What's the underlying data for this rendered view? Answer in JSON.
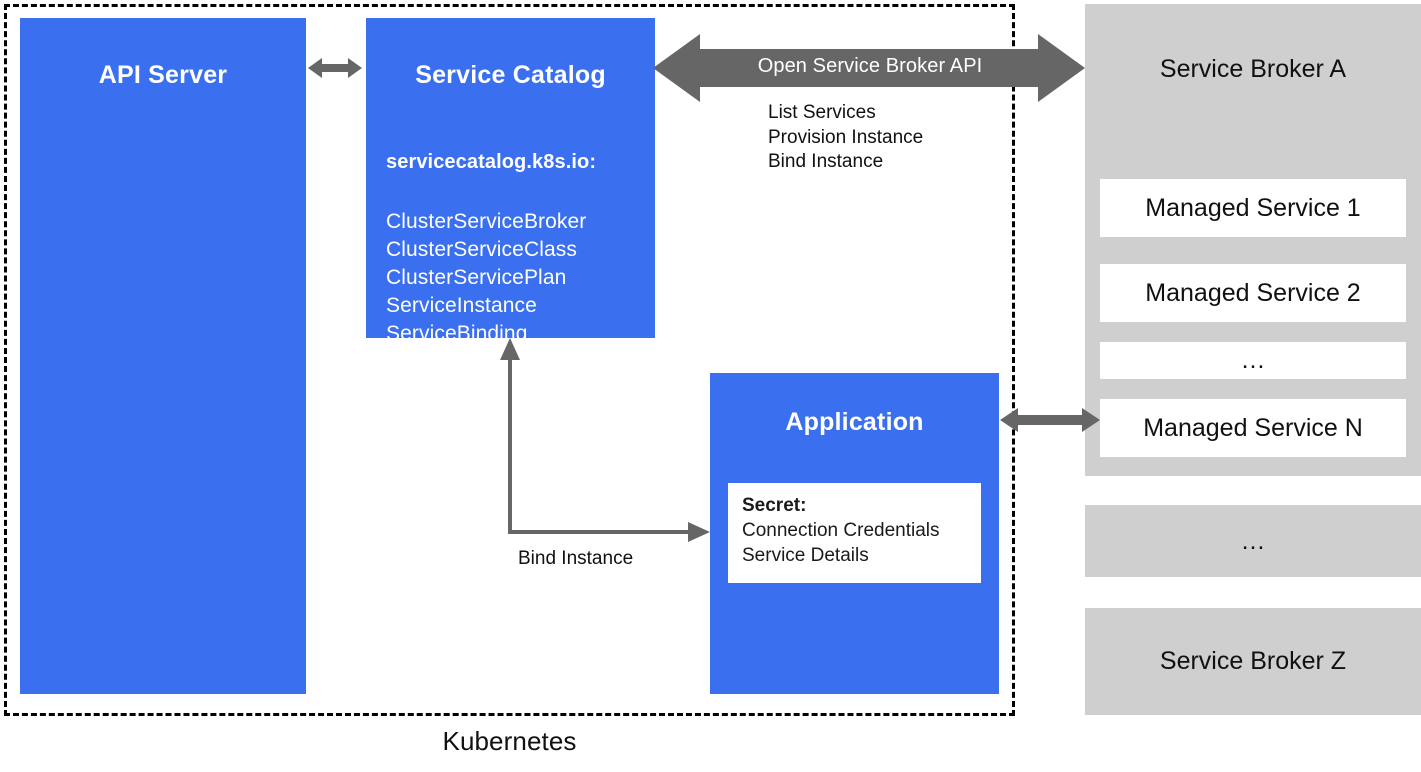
{
  "boundary": {
    "label": "Kubernetes"
  },
  "api_server": {
    "title": "API Server"
  },
  "service_catalog": {
    "title": "Service Catalog",
    "api_group": "servicecatalog.k8s.io:",
    "resources": [
      "ClusterServiceBroker",
      "ClusterServiceClass",
      "ClusterServicePlan",
      "ServiceInstance",
      "ServiceBinding"
    ]
  },
  "application": {
    "title": "Application",
    "secret": {
      "title": "Secret:",
      "lines": [
        "Connection Credentials",
        "Service Details"
      ]
    }
  },
  "osb_api": {
    "label": "Open Service Broker API",
    "operations": [
      "List Services",
      "Provision Instance",
      "Bind Instance"
    ]
  },
  "bind_connector": {
    "label": "Bind Instance"
  },
  "brokers": {
    "broker_a": {
      "title": "Service Broker A",
      "services": [
        "Managed Service 1",
        "Managed Service 2",
        "…",
        "Managed Service N"
      ]
    },
    "ellipsis": "…",
    "broker_z": {
      "title": "Service Broker Z"
    }
  },
  "colors": {
    "blue": "#3a6ff0",
    "gray_panel": "#cfcfcf",
    "arrow_gray": "#666666",
    "white": "#ffffff",
    "text_black": "#111111"
  }
}
